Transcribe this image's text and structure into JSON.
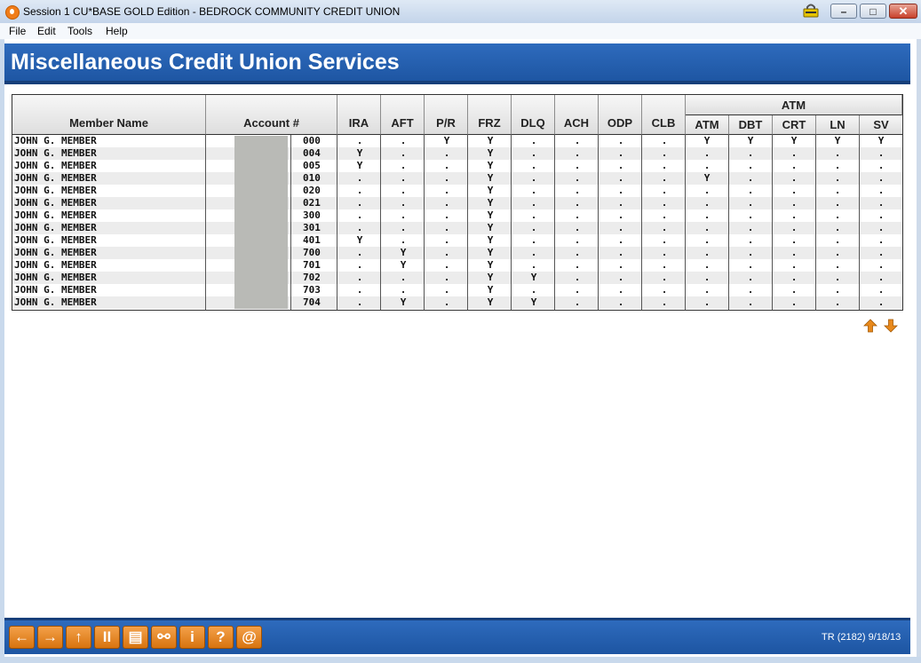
{
  "window": {
    "title": "Session 1 CU*BASE GOLD Edition - BEDROCK COMMUNITY CREDIT UNION",
    "minimize": "–",
    "maximize": "□",
    "close": "✕"
  },
  "menu": [
    "File",
    "Edit",
    "Tools",
    "Help"
  ],
  "page_title": "Miscellaneous Credit Union Services",
  "table": {
    "group_header": "ATM",
    "headers": {
      "member_name": "Member Name",
      "account": "Account #",
      "ira": "IRA",
      "aft": "AFT",
      "pr": "P/R",
      "frz": "FRZ",
      "dlq": "DLQ",
      "ach": "ACH",
      "odp": "ODP",
      "clb": "CLB",
      "atm": "ATM",
      "dbt": "DBT",
      "crt": "CRT",
      "ln": "LN",
      "sv": "SV"
    },
    "rows": [
      {
        "name": "JOHN G. MEMBER",
        "suffix": "000",
        "flags": [
          ".",
          ".",
          "Y",
          "Y",
          ".",
          ".",
          ".",
          ".",
          "Y",
          "Y",
          "Y",
          "Y",
          "Y"
        ]
      },
      {
        "name": "JOHN G. MEMBER",
        "suffix": "004",
        "flags": [
          "Y",
          ".",
          ".",
          "Y",
          ".",
          ".",
          ".",
          ".",
          ".",
          ".",
          ".",
          ".",
          "."
        ]
      },
      {
        "name": "JOHN G. MEMBER",
        "suffix": "005",
        "flags": [
          "Y",
          ".",
          ".",
          "Y",
          ".",
          ".",
          ".",
          ".",
          ".",
          ".",
          ".",
          ".",
          "."
        ]
      },
      {
        "name": "JOHN G. MEMBER",
        "suffix": "010",
        "flags": [
          ".",
          ".",
          ".",
          "Y",
          ".",
          ".",
          ".",
          ".",
          "Y",
          ".",
          ".",
          ".",
          "."
        ]
      },
      {
        "name": "JOHN G. MEMBER",
        "suffix": "020",
        "flags": [
          ".",
          ".",
          ".",
          "Y",
          ".",
          ".",
          ".",
          ".",
          ".",
          ".",
          ".",
          ".",
          "."
        ]
      },
      {
        "name": "JOHN G. MEMBER",
        "suffix": "021",
        "flags": [
          ".",
          ".",
          ".",
          "Y",
          ".",
          ".",
          ".",
          ".",
          ".",
          ".",
          ".",
          ".",
          "."
        ]
      },
      {
        "name": "JOHN G. MEMBER",
        "suffix": "300",
        "flags": [
          ".",
          ".",
          ".",
          "Y",
          ".",
          ".",
          ".",
          ".",
          ".",
          ".",
          ".",
          ".",
          "."
        ]
      },
      {
        "name": "JOHN G. MEMBER",
        "suffix": "301",
        "flags": [
          ".",
          ".",
          ".",
          "Y",
          ".",
          ".",
          ".",
          ".",
          ".",
          ".",
          ".",
          ".",
          "."
        ]
      },
      {
        "name": "JOHN G. MEMBER",
        "suffix": "401",
        "flags": [
          "Y",
          ".",
          ".",
          "Y",
          ".",
          ".",
          ".",
          ".",
          ".",
          ".",
          ".",
          ".",
          "."
        ]
      },
      {
        "name": "JOHN G. MEMBER",
        "suffix": "700",
        "flags": [
          ".",
          "Y",
          ".",
          "Y",
          ".",
          ".",
          ".",
          ".",
          ".",
          ".",
          ".",
          ".",
          "."
        ]
      },
      {
        "name": "JOHN G. MEMBER",
        "suffix": "701",
        "flags": [
          ".",
          "Y",
          ".",
          "Y",
          ".",
          ".",
          ".",
          ".",
          ".",
          ".",
          ".",
          ".",
          "."
        ]
      },
      {
        "name": "JOHN G. MEMBER",
        "suffix": "702",
        "flags": [
          ".",
          ".",
          ".",
          "Y",
          "Y",
          ".",
          ".",
          ".",
          ".",
          ".",
          ".",
          ".",
          "."
        ]
      },
      {
        "name": "JOHN G. MEMBER",
        "suffix": "703",
        "flags": [
          ".",
          ".",
          ".",
          "Y",
          ".",
          ".",
          ".",
          ".",
          ".",
          ".",
          ".",
          ".",
          "."
        ]
      },
      {
        "name": "JOHN G. MEMBER",
        "suffix": "704",
        "flags": [
          ".",
          "Y",
          ".",
          "Y",
          "Y",
          ".",
          ".",
          ".",
          ".",
          ".",
          ".",
          ".",
          "."
        ]
      }
    ]
  },
  "footer": {
    "buttons": [
      {
        "name": "back-button",
        "icon": "arrow-left-icon",
        "glyph": "←"
      },
      {
        "name": "forward-button",
        "icon": "arrow-right-icon",
        "glyph": "→"
      },
      {
        "name": "up-button",
        "icon": "arrow-up-icon",
        "glyph": "↑"
      },
      {
        "name": "pause-button",
        "icon": "pause-icon",
        "glyph": "II"
      },
      {
        "name": "print-button",
        "icon": "printer-icon",
        "glyph": "▤"
      },
      {
        "name": "link-button",
        "icon": "link-icon",
        "glyph": "⚯"
      },
      {
        "name": "info-button",
        "icon": "info-icon",
        "glyph": "i"
      },
      {
        "name": "help-button",
        "icon": "help-icon",
        "glyph": "?"
      },
      {
        "name": "email-button",
        "icon": "at-sign-icon",
        "glyph": "@"
      }
    ],
    "status": "TR (2182) 9/18/13"
  },
  "colors": {
    "header_band": "#1e56a3",
    "accent_orange": "#e8891c"
  }
}
